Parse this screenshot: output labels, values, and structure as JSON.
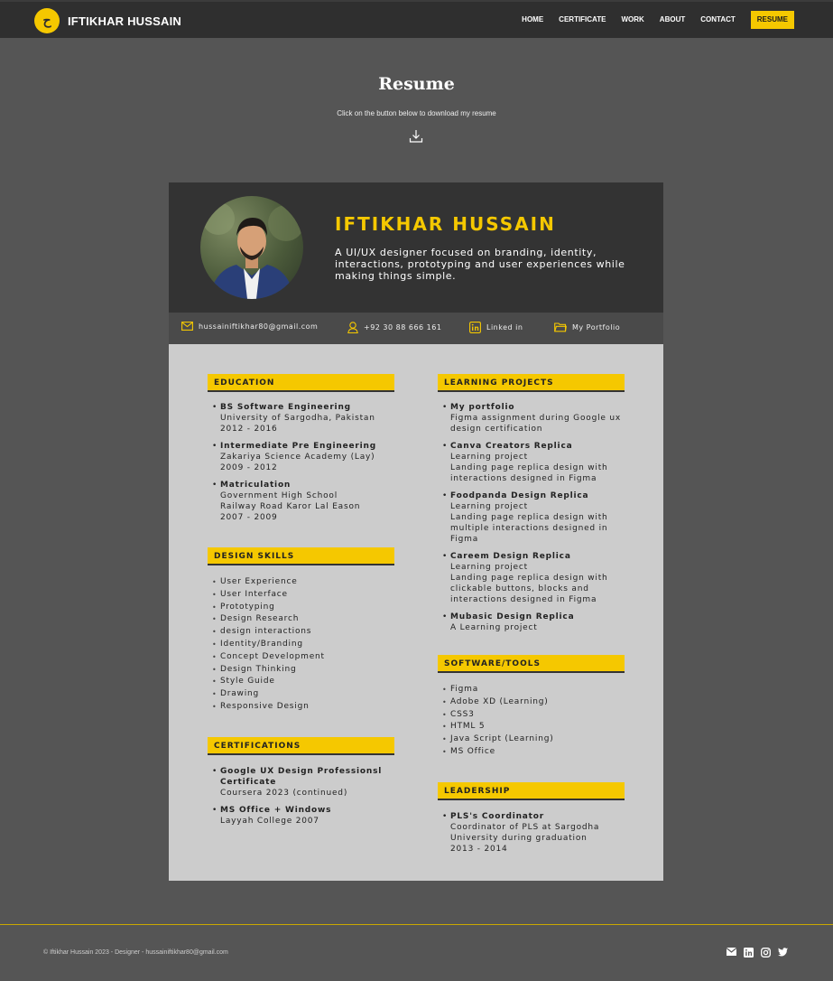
{
  "nav": {
    "brand": "IFTIKHAR HUSSAIN",
    "logo_text": "ح",
    "links": [
      "HOME",
      "CERTIFICATE",
      "WORK",
      "ABOUT",
      "CONTACT",
      "RESUME"
    ],
    "active": "RESUME"
  },
  "hero": {
    "title": "Resume",
    "subtitle": "Click on the button below to download my resume"
  },
  "resume": {
    "name": "IFTIKHAR HUSSAIN",
    "tagline": "A UI/UX designer focused on branding, identity, interactions, prototyping and user experiences while making things simple.",
    "contacts": {
      "email": "hussainiftikhar80@gmail.com",
      "phone": "+92 30 88 666 161",
      "linkedin": "Linked in",
      "portfolio": "My Portfolio"
    },
    "education": {
      "heading": "EDUCATION",
      "items": [
        {
          "title": "BS Software Engineering",
          "lines": [
            "University of Sargodha, Pakistan",
            "2012 - 2016"
          ]
        },
        {
          "title": "Intermediate Pre Engineering",
          "lines": [
            "Zakariya Science Academy (Lay)",
            "2009 - 2012"
          ]
        },
        {
          "title": "Matriculation",
          "lines": [
            "Government High School",
            "Railway Road Karor Lal Eason",
            "2007 - 2009"
          ]
        }
      ]
    },
    "design_skills": {
      "heading": "DESIGN SKILLS",
      "items": [
        "User Experience",
        "User Interface",
        "Prototyping",
        "Design Research",
        "design interactions",
        "Identity/Branding",
        "Concept Development",
        "Design Thinking",
        "Style Guide",
        "Drawing",
        "Responsive Design"
      ]
    },
    "certifications": {
      "heading": "CERTIFICATIONS",
      "items": [
        {
          "title": "Google UX Design Professionsl Certificate",
          "lines": [
            "Coursera 2023 (continued)"
          ]
        },
        {
          "title": "MS Office + Windows",
          "lines": [
            "Layyah College 2007"
          ]
        }
      ]
    },
    "learning_projects": {
      "heading": "LEARNING PROJECTS",
      "items": [
        {
          "title": "My portfolio",
          "lines": [
            "Figma assignment during Google ux design certification"
          ]
        },
        {
          "title": "Canva Creators Replica",
          "lines": [
            "Learning project",
            "Landing page replica design with interactions designed in Figma"
          ]
        },
        {
          "title": "Foodpanda Design Replica",
          "lines": [
            "Learning project",
            "Landing page replica design with multiple interactions designed in Figma"
          ]
        },
        {
          "title": "Careem Design Replica",
          "lines": [
            "Learning project",
            "Landing page replica design with clickable buttons, blocks and interactions designed in Figma"
          ]
        },
        {
          "title": "Mubasic Design Replica",
          "lines": [
            "A Learning project"
          ]
        }
      ]
    },
    "software_tools": {
      "heading": "SOFTWARE/TOOLS",
      "items": [
        "Figma",
        "Adobe XD (Learning)",
        "CSS3",
        "HTML 5",
        "Java Script (Learning)",
        "MS Office"
      ]
    },
    "leadership": {
      "heading": "LEADERSHIP",
      "items": [
        {
          "title": "PLS's Coordinator",
          "lines": [
            "Coordinator of PLS at Sargodha University during graduation",
            "2013 - 2014"
          ]
        }
      ]
    }
  },
  "footer": {
    "text": "© Iftikhar Hussain 2023 - Designer - hussainiftikhar80@gmail.com",
    "socials": [
      "mail-icon",
      "linkedin-icon",
      "instagram-icon",
      "twitter-icon"
    ]
  },
  "colors": {
    "accent": "#f5c800",
    "page_bg": "#555555",
    "nav_bg": "#2f2f2f",
    "card_bg": "#cccccc",
    "card_header_bg": "#333333"
  }
}
